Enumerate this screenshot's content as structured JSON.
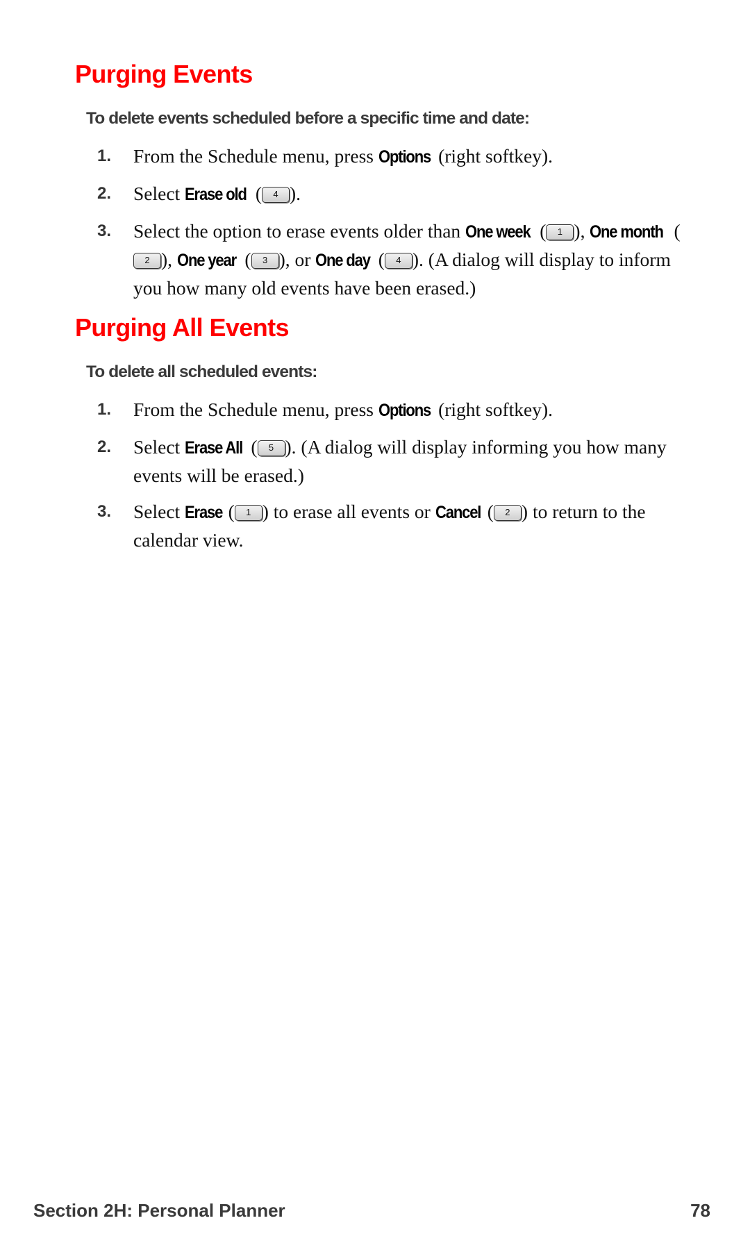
{
  "section1": {
    "title": "Purging Events",
    "subtitle": "To delete events scheduled before a specific time and date:",
    "steps": [
      {
        "num": "1.",
        "parts": [
          {
            "t": "From the Schedule menu, press "
          },
          {
            "b": "Options"
          },
          {
            "t": " (right softkey)."
          }
        ]
      },
      {
        "num": "2.",
        "parts": [
          {
            "t": "Select "
          },
          {
            "b": "Erase old"
          },
          {
            "t": " ("
          },
          {
            "k": "4"
          },
          {
            "t": ")."
          }
        ]
      },
      {
        "num": "3.",
        "parts": [
          {
            "t": "Select the option to erase events older than "
          },
          {
            "b": "One week"
          },
          {
            "t": " ("
          },
          {
            "k": "1"
          },
          {
            "t": "), "
          },
          {
            "b": "One month"
          },
          {
            "t": " ("
          },
          {
            "k": "2"
          },
          {
            "t": "), "
          },
          {
            "b": "One year"
          },
          {
            "t": " ("
          },
          {
            "k": "3"
          },
          {
            "t": "), or "
          },
          {
            "b": "One day"
          },
          {
            "t": " ("
          },
          {
            "k": "4"
          },
          {
            "t": "). (A dialog will display to inform you how many old events have been erased.)"
          }
        ]
      }
    ]
  },
  "section2": {
    "title": "Purging All Events",
    "subtitle": "To delete all scheduled events:",
    "steps": [
      {
        "num": "1.",
        "parts": [
          {
            "t": "From the Schedule menu, press "
          },
          {
            "b": "Options"
          },
          {
            "t": " (right softkey)."
          }
        ]
      },
      {
        "num": "2.",
        "parts": [
          {
            "t": "Select "
          },
          {
            "b": "Erase All"
          },
          {
            "t": " ("
          },
          {
            "k": "5"
          },
          {
            "t": "). (A dialog will display informing you how many events will be erased.)"
          }
        ]
      },
      {
        "num": "3.",
        "parts": [
          {
            "t": "Select "
          },
          {
            "b": "Erase"
          },
          {
            "t": " ("
          },
          {
            "k": "1"
          },
          {
            "t": ") to erase all events or "
          },
          {
            "b": "Cancel"
          },
          {
            "t": " ("
          },
          {
            "k": "2"
          },
          {
            "t": ") to return to the calendar view."
          }
        ]
      }
    ]
  },
  "footer": {
    "section": "Section 2H: Personal Planner",
    "page": "78"
  }
}
